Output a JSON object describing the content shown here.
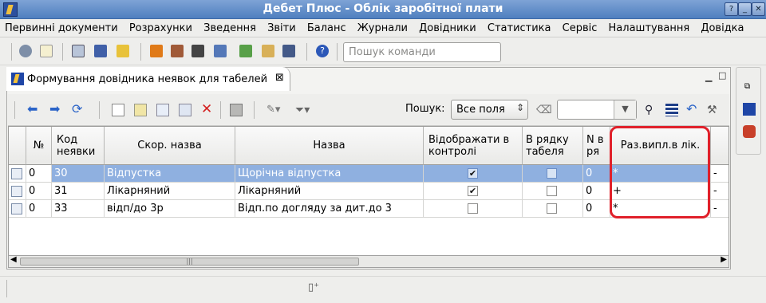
{
  "window": {
    "title": "Дебет Плюс - Облік заробітної плати"
  },
  "menu": [
    "Первинні документи",
    "Розрахунки",
    "Зведення",
    "Звіти",
    "Баланс",
    "Журнали",
    "Довідники",
    "Статистика",
    "Сервіс",
    "Налаштування",
    "Довідка"
  ],
  "command_search": {
    "placeholder": "Пошук команди"
  },
  "tab": {
    "label": "Формування довідника неявок для табелей"
  },
  "search": {
    "label": "Пошук:",
    "scope": "Все поля",
    "value": ""
  },
  "columns": {
    "row_num": "№",
    "code": "Код неявки",
    "short": "Скор. назва",
    "name": "Назва",
    "show": "Відображати в контролі",
    "in_row": "В рядку табеля",
    "n_row": "N в ря",
    "sep": "Раз.випл.в лік."
  },
  "rows": [
    {
      "num": "0",
      "code": "30",
      "short": "Відпустка",
      "name": "Щорічна відпустка",
      "show": true,
      "in_row": false,
      "n_row": "0",
      "sep": "*",
      "extra": "-",
      "selected": true
    },
    {
      "num": "0",
      "code": "31",
      "short": "Лікарняний",
      "name": "Лікарняний",
      "show": true,
      "in_row": false,
      "n_row": "0",
      "sep": "+",
      "extra": "-",
      "selected": false
    },
    {
      "num": "0",
      "code": "33",
      "short": "відп/до 3р",
      "name": "Відп.по догляду за дит.до 3",
      "show": false,
      "in_row": false,
      "n_row": "0",
      "sep": "*",
      "extra": "-",
      "selected": false
    }
  ],
  "colors": {
    "selection": "#8fb0e0",
    "highlight": "#e0202a",
    "titlebar": "#5b86c4"
  }
}
